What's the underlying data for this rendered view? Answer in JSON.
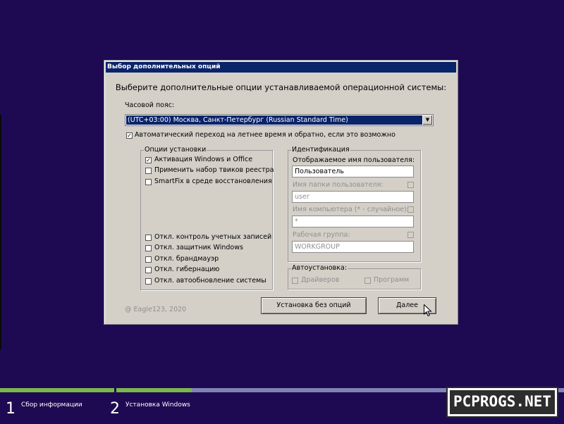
{
  "dialog": {
    "title": "Выбор дополнительных опций",
    "heading": "Выберите дополнительные опции устанавливаемой операционной системы:",
    "timezone": {
      "label": "Часовой пояс:",
      "value": "(UTC+03:00) Москва, Санкт-Петербург (Russian Standard Time)"
    },
    "dst": {
      "label": "Автоматический переход на летнее время и обратно, если это возможно",
      "checked": true
    },
    "install_options": {
      "title": "Опции установки",
      "items": [
        {
          "label": "Активация Windows и Office",
          "checked": true
        },
        {
          "label": "Применить набор твиков реестра",
          "checked": false
        },
        {
          "label": "SmartFix в среде восстановления",
          "checked": false
        },
        {
          "label": "Откл. контроль учетных записей",
          "checked": false
        },
        {
          "label": "Откл. защитник Windows",
          "checked": false
        },
        {
          "label": "Откл. брандмауэр",
          "checked": false
        },
        {
          "label": "Откл. гибернацию",
          "checked": false
        },
        {
          "label": "Откл. автообновление системы",
          "checked": false
        }
      ]
    },
    "identification": {
      "title": "Идентификация",
      "display_name_label": "Отображаемое имя пользователя:",
      "display_name_value": "Пользователь",
      "user_folder_label": "Имя папки пользователя:",
      "user_folder_value": "user",
      "computer_name_label": "Имя компьютера (* - случайное):",
      "computer_name_value": "*",
      "workgroup_label": "Рабочая группа:",
      "workgroup_value": "WORKGROUP"
    },
    "autoinstall": {
      "title": "Автоустановка:",
      "drivers_label": "Драйверов",
      "programs_label": "Программ"
    },
    "copyright": "@ Eagle123, 2020",
    "buttons": {
      "no_options": "Установка без опций",
      "next": "Далее"
    }
  },
  "steps": [
    {
      "number": "1",
      "label": "Сбор информации"
    },
    {
      "number": "2",
      "label": "Установка Windows"
    }
  ],
  "progress_fraction": 0.34,
  "watermark": "PCPROGS.NET",
  "colors": {
    "background": "#1e0a52",
    "dialog": "#d4d0c8",
    "titlebar": "#0a246a",
    "progress_done": "#7cb64e",
    "progress_rest": "#8183b6"
  }
}
